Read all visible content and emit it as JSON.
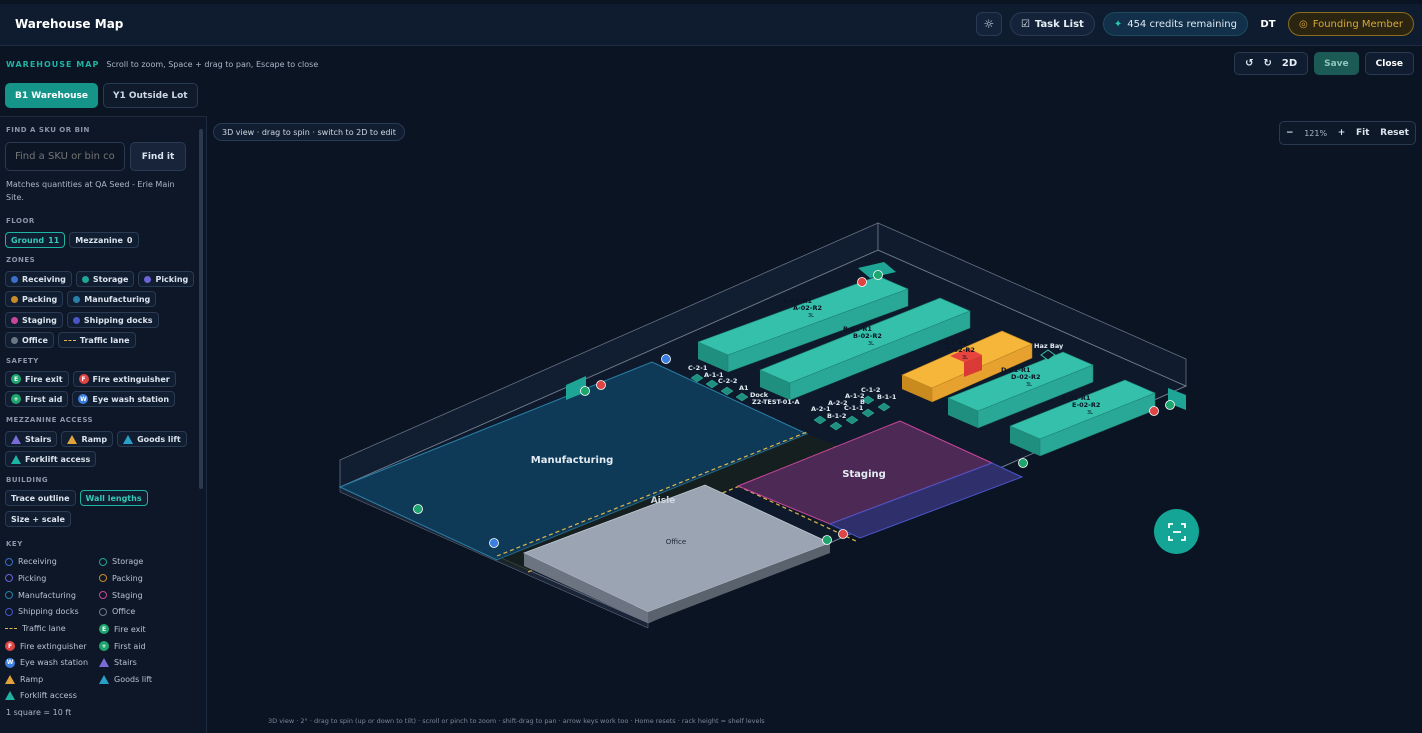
{
  "app": {
    "title": "Warehouse Map",
    "task_list": "Task List",
    "credits": "454 credits remaining",
    "avatar": "DT",
    "founder": "Founding Member"
  },
  "subheader": {
    "brand": "WAREHOUSE MAP",
    "hint": "Scroll to zoom, Space + drag to pan, Escape to close",
    "mode": "2D",
    "save": "Save",
    "close": "Close"
  },
  "tabs": [
    {
      "code": "B1",
      "label": "Warehouse",
      "active": true
    },
    {
      "code": "Y1",
      "label": "Outside Lot",
      "active": false
    }
  ],
  "sidebar": {
    "find_title": "FIND A SKU OR BIN",
    "search_placeholder": "Find a SKU or bin code",
    "find_button": "Find it",
    "matches": "Matches quantities at QA Seed - Erie Main Site.",
    "floor_title": "FLOOR",
    "floors": [
      {
        "label": "Ground",
        "count": "11",
        "active": true
      },
      {
        "label": "Mezzanine",
        "count": "0",
        "active": false
      }
    ],
    "zones_title": "ZONES",
    "zones": [
      {
        "label": "Receiving",
        "color": "#3b6fc8"
      },
      {
        "label": "Storage",
        "color": "#1fa596"
      },
      {
        "label": "Picking",
        "color": "#6c63d6"
      },
      {
        "label": "Packing",
        "color": "#c98a2a"
      },
      {
        "label": "Manufacturing",
        "color": "#2a7fa8"
      },
      {
        "label": "Staging",
        "color": "#c9479a"
      },
      {
        "label": "Shipping docks",
        "color": "#4b55c8"
      },
      {
        "label": "Office",
        "color": "#6b7787"
      },
      {
        "label": "Traffic lane",
        "color": "#e0b64a"
      }
    ],
    "safety_title": "SAFETY",
    "safety": [
      {
        "label": "Fire exit",
        "glyph": "E",
        "color": "#1fa56e"
      },
      {
        "label": "Fire extinguisher",
        "glyph": "F",
        "color": "#e04545"
      },
      {
        "label": "First aid",
        "glyph": "+",
        "color": "#1fa56e"
      },
      {
        "label": "Eye wash station",
        "glyph": "W",
        "color": "#3b7fe0"
      }
    ],
    "mezz_title": "MEZZANINE ACCESS",
    "mezz": [
      {
        "label": "Stairs",
        "color": "#7a6cd8"
      },
      {
        "label": "Ramp",
        "color": "#e0a23a"
      },
      {
        "label": "Goods lift",
        "color": "#2aa0c8"
      },
      {
        "label": "Forklift access",
        "color": "#1fb3a3"
      }
    ],
    "building_title": "BUILDING",
    "building": [
      {
        "label": "Trace outline",
        "active": false
      },
      {
        "label": "Wall lengths",
        "active": true
      },
      {
        "label": "Size + scale",
        "active": false
      }
    ],
    "key_title": "KEY",
    "key": [
      {
        "label": "Receiving",
        "kind": "ring",
        "color": "#3b6fc8"
      },
      {
        "label": "Storage",
        "kind": "ring",
        "color": "#1fa596"
      },
      {
        "label": "Picking",
        "kind": "ring",
        "color": "#6c63d6"
      },
      {
        "label": "Packing",
        "kind": "ring",
        "color": "#c98a2a"
      },
      {
        "label": "Manufacturing",
        "kind": "ring",
        "color": "#2a7fa8"
      },
      {
        "label": "Staging",
        "kind": "ring",
        "color": "#c9479a"
      },
      {
        "label": "Shipping docks",
        "kind": "ring",
        "color": "#4b55c8"
      },
      {
        "label": "Office",
        "kind": "ring",
        "color": "#6b7787"
      },
      {
        "label": "Traffic lane",
        "kind": "dash",
        "color": "#e0b64a"
      },
      {
        "label": "Fire exit",
        "kind": "badge",
        "glyph": "E",
        "color": "#1fa56e"
      },
      {
        "label": "Fire extinguisher",
        "kind": "badge",
        "glyph": "F",
        "color": "#e04545"
      },
      {
        "label": "First aid",
        "kind": "badge",
        "glyph": "+",
        "color": "#1fa56e"
      },
      {
        "label": "Eye wash station",
        "kind": "badge",
        "glyph": "W",
        "color": "#3b7fe0"
      },
      {
        "label": "Stairs",
        "kind": "tri",
        "color": "#7a6cd8"
      },
      {
        "label": "Ramp",
        "kind": "tri",
        "color": "#e0a23a"
      },
      {
        "label": "Goods lift",
        "kind": "tri",
        "color": "#2aa0c8"
      },
      {
        "label": "Forklift access",
        "kind": "tri",
        "color": "#1fb3a3"
      }
    ],
    "scale": "1 square = 10 ft"
  },
  "canvas": {
    "view_hint": "3D view · drag to spin · switch to 2D to edit",
    "zoom": "121%",
    "fit": "Fit",
    "reset": "Reset",
    "bottom_hint": "3D view · 2° · drag to spin (up or down to tilt) · scroll or pinch to zoom · shift-drag to pan · arrow keys work too · Home resets · rack height = shelf levels",
    "zone_labels": {
      "manufacturing": "Manufacturing",
      "staging": "Staging",
      "office": "Office",
      "aisle": "Aisle",
      "haz": "Haz Bay",
      "dock": "Dock",
      "ztest": "Z2-TEST-01-A"
    },
    "racks": [
      {
        "top": "A-01-R1",
        "sub": "A-02-R2",
        "lv": "3L"
      },
      {
        "top": "B-01-R1",
        "sub": "B-02-R2",
        "lv": "3L"
      },
      {
        "top": "C-01-R1",
        "sub": "C-02-R2",
        "lv": "3L"
      },
      {
        "top": "D-01-R1",
        "sub": "D-02-R2",
        "lv": "3L"
      },
      {
        "top": "E-01-R1",
        "sub": "E-02-R2",
        "lv": "3L"
      }
    ],
    "bins": [
      "C-2-1",
      "A-1-1",
      "C-2-2",
      "A1",
      "A-2-2",
      "A-1-2",
      "C-1-2",
      "A-2-1",
      "C-1-1",
      "B-1-1",
      "B-1-2",
      "B"
    ]
  }
}
